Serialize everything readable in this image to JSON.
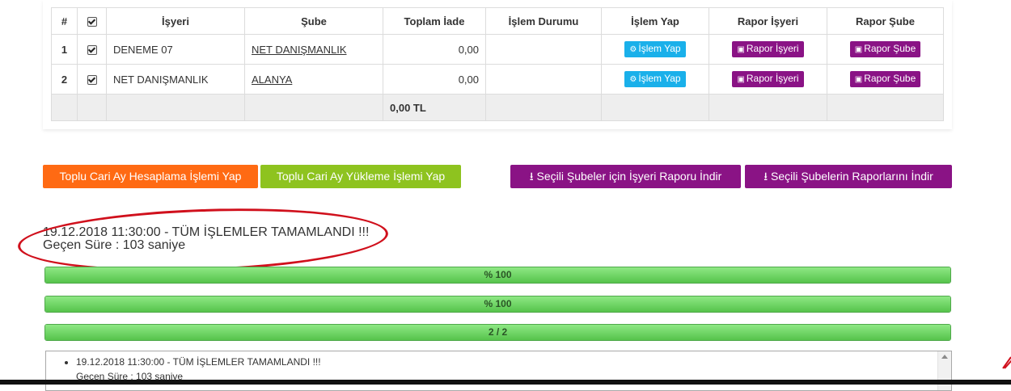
{
  "table": {
    "headers": [
      "#",
      "",
      "İşyeri",
      "Şube",
      "Toplam İade",
      "İşlem Durumu",
      "İşlem Yap",
      "Rapor İşyeri",
      "Rapor Şube"
    ],
    "rows": [
      {
        "idx": "1",
        "isyeri": "DENEME 07",
        "sube": "NET DANIŞMANLIK",
        "toplam": "0,00",
        "durum": "",
        "btn_islem": "İşlem Yap",
        "btn_rapor_isyeri": "Rapor İşyeri",
        "btn_rapor_sube": "Rapor Şube"
      },
      {
        "idx": "2",
        "isyeri": "NET DANIŞMANLIK",
        "sube": "ALANYA",
        "toplam": "0,00",
        "durum": "",
        "btn_islem": "İşlem Yap",
        "btn_rapor_isyeri": "Rapor İşyeri",
        "btn_rapor_sube": "Rapor Şube"
      }
    ],
    "total": "0,00 TL"
  },
  "actions": {
    "toplu_hesaplama": "Toplu Cari Ay Hesaplama İşlemi Yap",
    "toplu_yukleme": "Toplu Cari Ay Yükleme İşlemi Yap",
    "secili_isyeri_raporu": "Seçili Şubeler için İşyeri Raporu İndir",
    "secili_sube_raporlari": "Seçili Şubelerin Raporlarını İndir"
  },
  "status": {
    "line1": "19.12.2018 11:30:00 - TÜM İŞLEMLER TAMAMLANDI !!!",
    "line2": "Geçen Süre : 103 saniye"
  },
  "progress": [
    {
      "label": "% 100",
      "value": 1.0
    },
    {
      "label": "% 100",
      "value": 1.0
    },
    {
      "label": "2 / 2",
      "value": 1.0
    }
  ],
  "log": {
    "items": [
      "19.12.2018 11:30:00 - TÜM İŞLEMLER TAMAMLANDI !!!"
    ],
    "sub": "Geçen Süre : 103 saniye"
  },
  "colors": {
    "orange": "#ff6a13",
    "green": "#8ec31f",
    "purple": "#8a1385",
    "blue": "#1ab0ea",
    "annotation_red": "#d0101c"
  },
  "icons": {
    "islem": "gears-icon",
    "rapor": "pdf-icon",
    "download": "download-icon"
  }
}
